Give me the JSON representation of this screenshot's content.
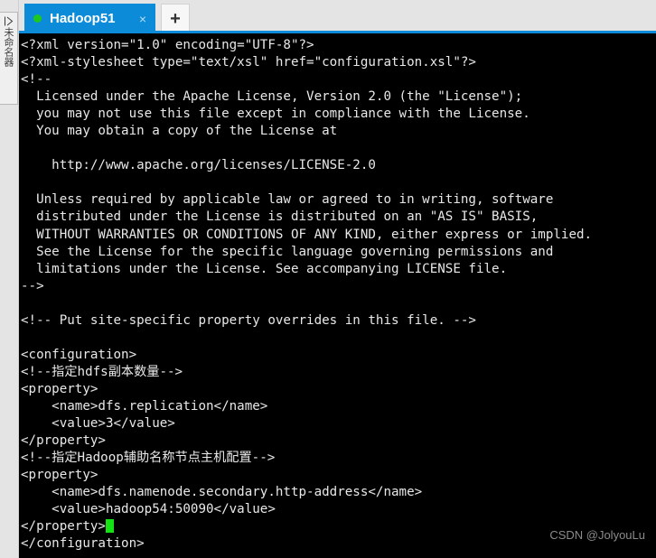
{
  "window": {
    "accent_color": "#0b8bd8",
    "terminal_bg": "#000000",
    "terminal_fg": "#e8e8e8",
    "cursor_color": "#15e215"
  },
  "sidebar": {
    "toggle_icon": "expand-panel-icon",
    "vertical_label": "未命名器"
  },
  "tabbar": {
    "active_tab": {
      "label": "Hadoop51",
      "status_dot_color": "#1ec81e",
      "close_label": "×"
    },
    "new_tab_label": "+"
  },
  "terminal": {
    "lines": [
      "<?xml version=\"1.0\" encoding=\"UTF-8\"?>",
      "<?xml-stylesheet type=\"text/xsl\" href=\"configuration.xsl\"?>",
      "<!--",
      "  Licensed under the Apache License, Version 2.0 (the \"License\");",
      "  you may not use this file except in compliance with the License.",
      "  You may obtain a copy of the License at",
      "",
      "    http://www.apache.org/licenses/LICENSE-2.0",
      "",
      "  Unless required by applicable law or agreed to in writing, software",
      "  distributed under the License is distributed on an \"AS IS\" BASIS,",
      "  WITHOUT WARRANTIES OR CONDITIONS OF ANY KIND, either express or implied.",
      "  See the License for the specific language governing permissions and",
      "  limitations under the License. See accompanying LICENSE file.",
      "-->",
      "",
      "<!-- Put site-specific property overrides in this file. -->",
      "",
      "<configuration>",
      "<!--指定hdfs副本数量-->",
      "<property>",
      "    <name>dfs.replication</name>",
      "    <value>3</value>",
      "</property>",
      "<!--指定Hadoop辅助名称节点主机配置-->",
      "<property>",
      "    <name>dfs.namenode.secondary.http-address</name>",
      "    <value>hadoop54:50090</value>",
      "</property>",
      "</configuration>"
    ],
    "cursor_line_index": 28,
    "cursor_column": 12
  },
  "watermark": {
    "text": "CSDN @JolyouLu"
  }
}
